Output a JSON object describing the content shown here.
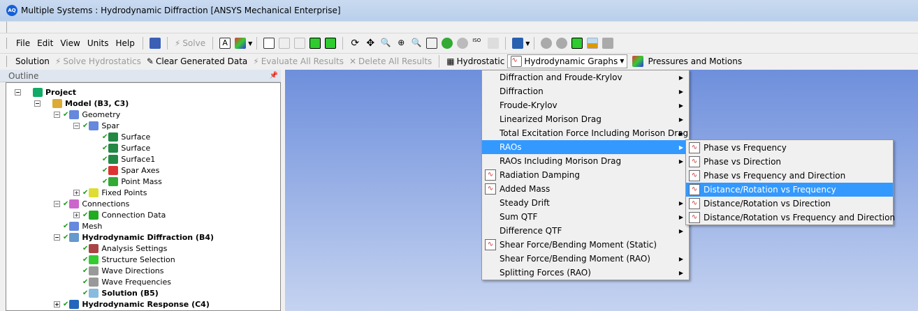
{
  "title": "Multiple Systems : Hydrodynamic Diffraction [ANSYS Mechanical Enterprise]",
  "app_icon": "AQ",
  "menubar": [
    "File",
    "Edit",
    "View",
    "Units",
    "Help"
  ],
  "toolbar1": {
    "solve": "Solve"
  },
  "toolbar2": {
    "solution": "Solution",
    "solve_hydrostatics": "Solve Hydrostatics",
    "clear_generated_data": "Clear Generated Data",
    "evaluate_all_results": "Evaluate All Results",
    "delete_all_results": "Delete All Results",
    "hydrostatic": "Hydrostatic",
    "hydrodynamic_graphs": "Hydrodynamic Graphs",
    "pressures_and_motions": "Pressures and Motions"
  },
  "outline": {
    "header": "Outline",
    "items": [
      "Project",
      "Model (B3, C3)",
      "Geometry",
      "Spar",
      "Surface",
      "Surface",
      "Surface1",
      "Spar Axes",
      "Point Mass",
      "Fixed Points",
      "Connections",
      "Connection Data",
      "Mesh",
      "Hydrodynamic Diffraction (B4)",
      "Analysis Settings",
      "Structure Selection",
      "Wave Directions",
      "Wave Frequencies",
      "Solution (B5)",
      "Hydrodynamic Response (C4)"
    ]
  },
  "menu": {
    "items": [
      "Diffraction and Froude-Krylov",
      "Diffraction",
      "Froude-Krylov",
      "Linearized Morison Drag",
      "Total Excitation Force Including Morison Drag",
      "RAOs",
      "RAOs Including Morison Drag",
      "Radiation Damping",
      "Added Mass",
      "Steady Drift",
      "Sum QTF",
      "Difference QTF",
      "Shear Force/Bending Moment (Static)",
      "Shear Force/Bending Moment (RAO)",
      "Splitting Forces (RAO)"
    ]
  },
  "submenu": {
    "items": [
      "Phase vs Frequency",
      "Phase vs Direction",
      "Phase vs Frequency and Direction",
      "Distance/Rotation vs Frequency",
      "Distance/Rotation vs Direction",
      "Distance/Rotation vs Frequency and Direction"
    ]
  },
  "colors": {
    "highlight": "#3399ff",
    "viewport_top": "#6e8fdc",
    "viewport_bottom": "#c5d3f0"
  }
}
